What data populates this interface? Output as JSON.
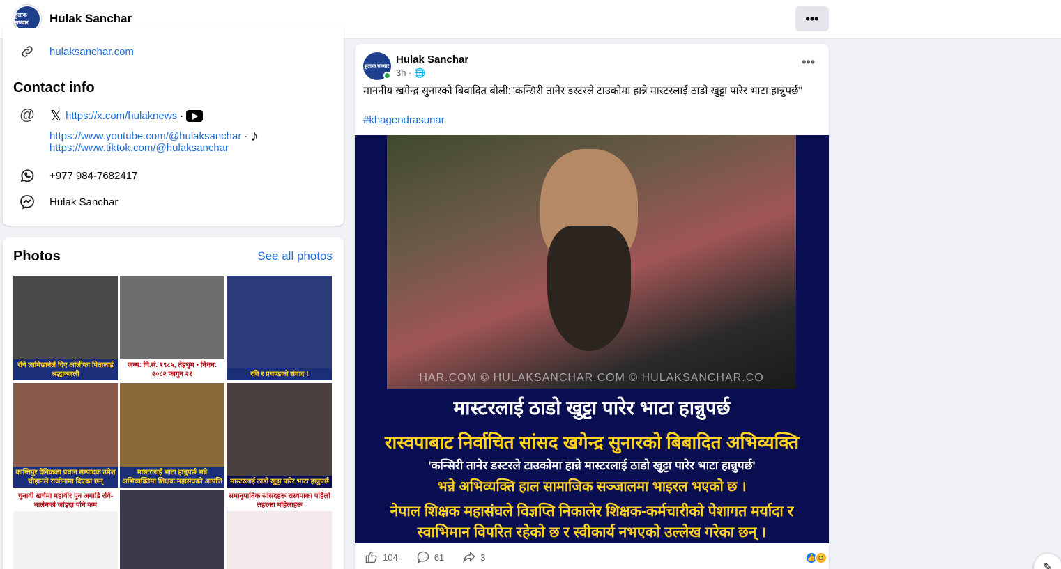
{
  "header": {
    "page_name": "Hulak Sanchar",
    "avatar_text": "हुलाक सञ्चार",
    "more_label": "•••"
  },
  "intro": {
    "website": "hulaksanchar.com",
    "contact_heading": "Contact info",
    "x_link": "https://x.com/hulaknews",
    "youtube_link": "https://www.youtube.com/@hulaksanchar",
    "tiktok_link": "https://www.tiktok.com/@hulaksanchar",
    "separator": "·",
    "phone": "+977 984-7682417",
    "messenger": "Hulak Sanchar"
  },
  "photos": {
    "heading": "Photos",
    "see_all": "See all photos",
    "items": [
      {
        "caption": "रवि लामिछानेले दिए ओलीका पितालाई श्रद्धाञ्जली",
        "bg": "#4a4a4a",
        "capbg": "#1a2e7a"
      },
      {
        "caption": "जन्म: वि.सं. १९८५, तेह्रथुम • निधन: २०८२ फागुन २१",
        "bg": "#6e6e6e",
        "capbg": "#ffffff"
      },
      {
        "caption": "रवि र प्रचण्डको संवाद !",
        "bg": "#2b3a7a",
        "capbg": "#1a2e7a"
      },
      {
        "caption": "कान्तिपुर दैनिकका प्रधान सम्पादक उमेश चौहानले राजीनामा दिएका छन्",
        "bg": "#8c5a4a",
        "capbg": "#1a2e7a"
      },
      {
        "caption": "मास्टरलाई भाटा हान्नुपर्छ भन्ने अभिव्यक्तिमा शिक्षक महासंघको आपत्ति",
        "bg": "#8a6a3a",
        "capbg": "#1a2e7a"
      },
      {
        "caption": "मास्टरलाई ठाडो खुट्टा पारेर भाटा हान्नुपर्छ",
        "bg": "#4a4040",
        "capbg": "#0a0f52"
      },
      {
        "caption": "चुनावी खर्चमा महावीर पुन अगाडि रवि-बालेनको जोड्दा पनि कम",
        "bg": "#f2f2f2",
        "capbg": "#ffffff"
      },
      {
        "caption": "",
        "bg": "#3a3a4a",
        "capbg": "#1a2e7a"
      },
      {
        "caption": "समानुपातिक सांसदहरू रास्वपाका पहिलो लहरका महिलाहरू",
        "bg": "#f4e9ea",
        "capbg": "#ffffff"
      }
    ]
  },
  "post": {
    "author": "Hulak Sanchar",
    "avatar_text": "हुलाक सञ्चार",
    "time": "3h · 🌐",
    "more_label": "•••",
    "text": "माननीय खगेन्द्र सुनारको बिबादित बोली:''कन्सिरी तानेर डस्टरले टाउकोमा हान्ने मास्टरलाई ठाडो खुट्टा पारेर भाटा हान्नुपर्छ''",
    "hashtag": "#khagendrasunar",
    "image": {
      "watermark": "HAR.COM  © HULAKSANCHAR.COM  © HULAKSANCHAR.CO",
      "headline": "मास्टरलाई ठाडो खुट्टा पारेर भाटा हान्नुपर्छ",
      "subhead": "रास्वपाबाट निर्वाचित सांसद खगेन्द्र सुनारको बिबादित अभिव्यक्ति",
      "quote": "'कन्सिरी तानेर डस्टरले टाउकोमा हान्ने मास्टरलाई ठाडो खुट्टा पारेर भाटा हान्नुपर्छ'",
      "line3": "भन्ने अभिव्यक्ति  हाल सामाजिक सञ्जालमा भाइरल भएको छ ।",
      "line4": "नेपाल शिक्षक महासंघले विज्ञप्ति निकालेर शिक्षक-कर्मचारीको पेशागत मर्यादा र",
      "line5": "स्वाभिमान विपरित रहेको छ र स्वीकार्य नभएको उल्लेख गरेका छन् ।"
    },
    "likes": "104",
    "comments": "61",
    "shares": "3"
  },
  "colors": {
    "link": "#216fdb",
    "yellow_text": "#ffd21f",
    "white": "#ffffff"
  }
}
